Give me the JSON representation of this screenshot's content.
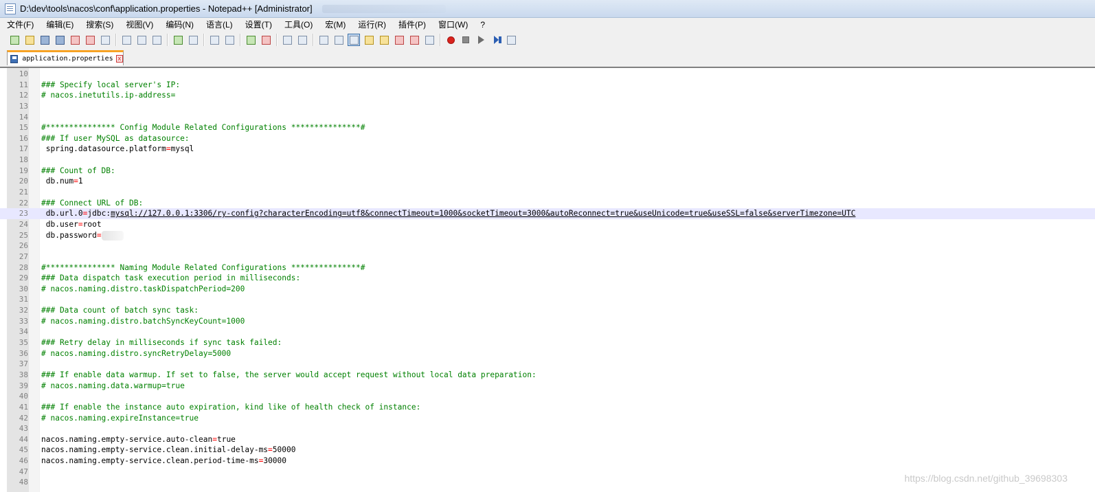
{
  "window": {
    "title": "D:\\dev\\tools\\nacos\\conf\\application.properties - Notepad++ [Administrator]"
  },
  "menu": [
    "文件(F)",
    "编辑(E)",
    "搜索(S)",
    "视图(V)",
    "编码(N)",
    "语言(L)",
    "设置(T)",
    "工具(O)",
    "宏(M)",
    "运行(R)",
    "插件(P)",
    "窗口(W)",
    "?"
  ],
  "toolbar": [
    {
      "icon": "new-file-icon",
      "style": "green"
    },
    {
      "icon": "open-file-icon",
      "style": "yellow"
    },
    {
      "icon": "save-icon",
      "style": "save"
    },
    {
      "icon": "save-all-icon",
      "style": "save"
    },
    {
      "icon": "close-icon",
      "style": "red"
    },
    {
      "icon": "close-all-icon",
      "style": "red"
    },
    {
      "icon": "print-icon",
      "style": ""
    },
    {
      "sep": true
    },
    {
      "icon": "cut-icon",
      "style": ""
    },
    {
      "icon": "copy-icon",
      "style": ""
    },
    {
      "icon": "paste-icon",
      "style": ""
    },
    {
      "sep": true
    },
    {
      "icon": "undo-icon",
      "style": "green"
    },
    {
      "icon": "redo-icon",
      "style": ""
    },
    {
      "sep": true
    },
    {
      "icon": "find-icon",
      "style": ""
    },
    {
      "icon": "replace-icon",
      "style": ""
    },
    {
      "sep": true
    },
    {
      "icon": "zoom-in-icon",
      "style": "green"
    },
    {
      "icon": "zoom-out-icon",
      "style": "red"
    },
    {
      "sep": true
    },
    {
      "icon": "sync-vertical-icon",
      "style": ""
    },
    {
      "icon": "sync-horizontal-icon",
      "style": ""
    },
    {
      "sep": true
    },
    {
      "icon": "word-wrap-icon",
      "style": ""
    },
    {
      "icon": "show-all-chars-icon",
      "style": ""
    },
    {
      "icon": "indent-guide-icon",
      "style": "",
      "active": true
    },
    {
      "icon": "user-language-icon",
      "style": "yellow"
    },
    {
      "icon": "document-map-icon",
      "style": "yellow"
    },
    {
      "icon": "function-list-icon",
      "style": "red"
    },
    {
      "icon": "folder-workspace-icon",
      "style": "red"
    },
    {
      "icon": "monitor-icon",
      "style": ""
    },
    {
      "sep": true
    },
    {
      "icon": "record-macro-icon",
      "style": "record"
    },
    {
      "icon": "stop-macro-icon",
      "style": "stop"
    },
    {
      "icon": "play-macro-icon",
      "style": "play"
    },
    {
      "icon": "run-macro-multiple-icon",
      "style": "ff"
    },
    {
      "icon": "save-macro-icon",
      "style": ""
    }
  ],
  "tab": {
    "label": "application.properties",
    "close": "x"
  },
  "editor": {
    "current_line": 23,
    "lines": [
      {
        "n": "10",
        "parts": []
      },
      {
        "n": "11",
        "parts": [
          {
            "t": "### Specify local server's IP:",
            "c": "comment"
          }
        ]
      },
      {
        "n": "12",
        "parts": [
          {
            "t": "# nacos.inetutils.ip-address=",
            "c": "comment"
          }
        ]
      },
      {
        "n": "13",
        "parts": []
      },
      {
        "n": "14",
        "parts": []
      },
      {
        "n": "15",
        "parts": [
          {
            "t": "#*************** Config Module Related Configurations ***************#",
            "c": "comment"
          }
        ]
      },
      {
        "n": "16",
        "parts": [
          {
            "t": "### If user MySQL as datasource:",
            "c": "comment"
          }
        ]
      },
      {
        "n": "17",
        "parts": [
          {
            "t": " spring.datasource.platform",
            "c": "key"
          },
          {
            "t": "=",
            "c": "op"
          },
          {
            "t": "mysql",
            "c": "key"
          }
        ]
      },
      {
        "n": "18",
        "parts": []
      },
      {
        "n": "19",
        "parts": [
          {
            "t": "### Count of DB:",
            "c": "comment"
          }
        ]
      },
      {
        "n": "20",
        "parts": [
          {
            "t": " db.num",
            "c": "key"
          },
          {
            "t": "=",
            "c": "op"
          },
          {
            "t": "1",
            "c": "key"
          }
        ]
      },
      {
        "n": "21",
        "parts": []
      },
      {
        "n": "22",
        "parts": [
          {
            "t": "### Connect URL of DB:",
            "c": "comment"
          }
        ]
      },
      {
        "n": "23",
        "parts": [
          {
            "t": " db.url.0",
            "c": "key"
          },
          {
            "t": "=",
            "c": "op"
          },
          {
            "t": "jdbc:",
            "c": "key"
          },
          {
            "t": "mysql://127.0.0.1:3306/ry-config?characterEncoding=utf8&connectTimeout=1000&socketTimeout=3000&autoReconnect=true&useUnicode=true&useSSL=false&serverTimezone=UTC",
            "c": "url"
          }
        ]
      },
      {
        "n": "24",
        "parts": [
          {
            "t": " db.user",
            "c": "key"
          },
          {
            "t": "=",
            "c": "op"
          },
          {
            "t": "root",
            "c": "key"
          }
        ]
      },
      {
        "n": "25",
        "parts": [
          {
            "t": " db.password",
            "c": "key"
          },
          {
            "t": "=",
            "c": "op"
          },
          {
            "t": "",
            "c": "redact"
          }
        ]
      },
      {
        "n": "26",
        "parts": []
      },
      {
        "n": "27",
        "parts": []
      },
      {
        "n": "28",
        "parts": [
          {
            "t": "#*************** Naming Module Related Configurations ***************#",
            "c": "comment"
          }
        ]
      },
      {
        "n": "29",
        "parts": [
          {
            "t": "### Data dispatch task execution period in milliseconds:",
            "c": "comment"
          }
        ]
      },
      {
        "n": "30",
        "parts": [
          {
            "t": "# nacos.naming.distro.taskDispatchPeriod=200",
            "c": "comment"
          }
        ]
      },
      {
        "n": "31",
        "parts": []
      },
      {
        "n": "32",
        "parts": [
          {
            "t": "### Data count of batch sync task:",
            "c": "comment"
          }
        ]
      },
      {
        "n": "33",
        "parts": [
          {
            "t": "# nacos.naming.distro.batchSyncKeyCount=1000",
            "c": "comment"
          }
        ]
      },
      {
        "n": "34",
        "parts": []
      },
      {
        "n": "35",
        "parts": [
          {
            "t": "### Retry delay in milliseconds if sync task failed:",
            "c": "comment"
          }
        ]
      },
      {
        "n": "36",
        "parts": [
          {
            "t": "# nacos.naming.distro.syncRetryDelay=5000",
            "c": "comment"
          }
        ]
      },
      {
        "n": "37",
        "parts": []
      },
      {
        "n": "38",
        "parts": [
          {
            "t": "### If enable data warmup. If set to false, the server would accept request without local data preparation:",
            "c": "comment"
          }
        ]
      },
      {
        "n": "39",
        "parts": [
          {
            "t": "# nacos.naming.data.warmup=true",
            "c": "comment"
          }
        ]
      },
      {
        "n": "40",
        "parts": []
      },
      {
        "n": "41",
        "parts": [
          {
            "t": "### If enable the instance auto expiration, kind like of health check of instance:",
            "c": "comment"
          }
        ]
      },
      {
        "n": "42",
        "parts": [
          {
            "t": "# nacos.naming.expireInstance=true",
            "c": "comment"
          }
        ]
      },
      {
        "n": "43",
        "parts": []
      },
      {
        "n": "44",
        "parts": [
          {
            "t": "nacos.naming.empty-service.auto-clean",
            "c": "key"
          },
          {
            "t": "=",
            "c": "op"
          },
          {
            "t": "true",
            "c": "key"
          }
        ]
      },
      {
        "n": "45",
        "parts": [
          {
            "t": "nacos.naming.empty-service.clean.initial-delay-ms",
            "c": "key"
          },
          {
            "t": "=",
            "c": "op"
          },
          {
            "t": "50000",
            "c": "key"
          }
        ]
      },
      {
        "n": "46",
        "parts": [
          {
            "t": "nacos.naming.empty-service.clean.period-time-ms",
            "c": "key"
          },
          {
            "t": "=",
            "c": "op"
          },
          {
            "t": "30000",
            "c": "key"
          }
        ]
      },
      {
        "n": "47",
        "parts": []
      },
      {
        "n": "48",
        "parts": []
      }
    ]
  },
  "watermark": "https://blog.csdn.net/github_39698303"
}
